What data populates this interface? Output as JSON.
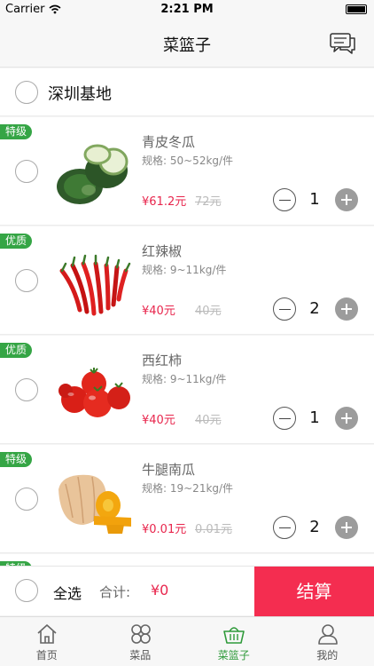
{
  "status_bar": {
    "carrier": "Carrier",
    "time": "2:21 PM"
  },
  "header": {
    "title": "菜篮子"
  },
  "store": {
    "name": "深圳基地"
  },
  "items": [
    {
      "badge": "特级",
      "name": "青皮冬瓜",
      "spec": "规格:  50~52kg/件",
      "price": "¥61.2元",
      "old_price": "72元",
      "qty": "1"
    },
    {
      "badge": "优质",
      "name": "红辣椒",
      "spec": "规格:  9~11kg/件",
      "price": "¥40元",
      "old_price": "40元",
      "qty": "2"
    },
    {
      "badge": "优质",
      "name": "西红柿",
      "spec": "规格:  9~11kg/件",
      "price": "¥40元",
      "old_price": "40元",
      "qty": "1"
    },
    {
      "badge": "特级",
      "name": "牛腿南瓜",
      "spec": "规格:  19~21kg/件",
      "price": "¥0.01元",
      "old_price": "0.01元",
      "qty": "2"
    },
    {
      "badge": "特级",
      "name": "",
      "spec": "",
      "price": "",
      "old_price": "",
      "qty": ""
    }
  ],
  "bottom": {
    "select_all": "全选",
    "total_label": "合计:",
    "total_value": "¥0",
    "checkout": "结算"
  },
  "tabs": [
    {
      "label": "首页",
      "icon": "home-icon"
    },
    {
      "label": "菜品",
      "icon": "clover-icon"
    },
    {
      "label": "菜篮子",
      "icon": "basket-icon"
    },
    {
      "label": "我的",
      "icon": "user-icon"
    }
  ],
  "colors": {
    "accent_red": "#f42d50",
    "badge_green": "#35a545",
    "tab_active": "#2f9a3a",
    "price": "#e8264d"
  }
}
